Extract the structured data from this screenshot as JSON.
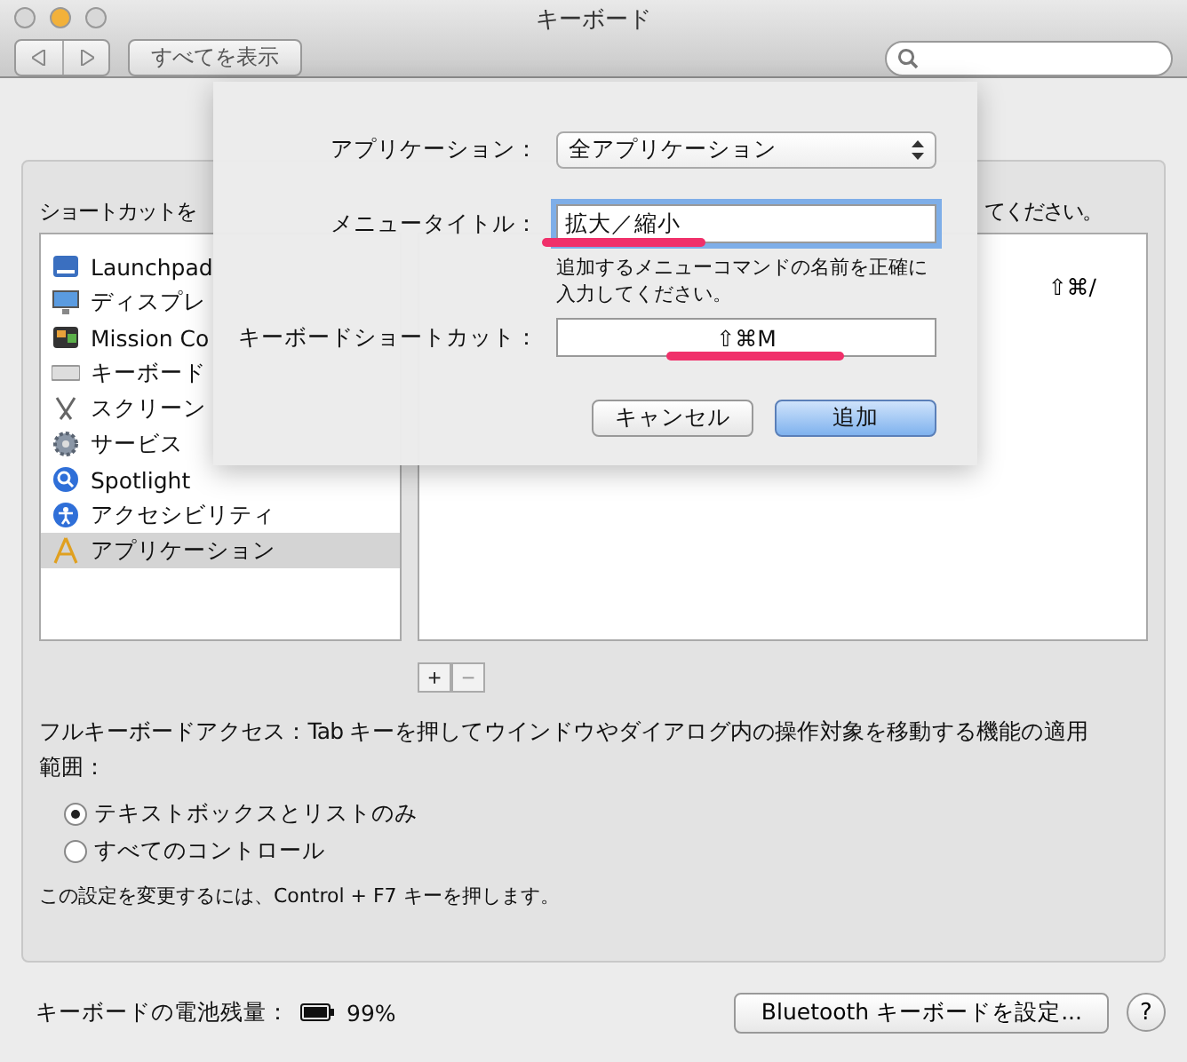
{
  "window": {
    "title": "キーボード"
  },
  "toolbar": {
    "show_all": "すべてを表示"
  },
  "shortcuts": {
    "heading_left": "ショートカットを",
    "heading_right": "てください。",
    "categories": [
      {
        "label": "Launchpad",
        "selected": false
      },
      {
        "label": "ディスプレ",
        "selected": false
      },
      {
        "label": "Mission Co",
        "selected": false
      },
      {
        "label": "キーボード",
        "selected": false
      },
      {
        "label": "スクリーン",
        "selected": false
      },
      {
        "label": "サービス",
        "selected": false
      },
      {
        "label": "Spotlight",
        "selected": false
      },
      {
        "label": "アクセシビリティ",
        "selected": false
      },
      {
        "label": "アプリケーション",
        "selected": true
      }
    ],
    "shortcut_value": "⇧⌘/",
    "add": "+",
    "remove": "−"
  },
  "full_keyboard_access": {
    "description": "フルキーボードアクセス：Tab キーを押してウインドウやダイアログ内の操作対象を移動する機能の適用範囲：",
    "options": [
      {
        "label": "テキストボックスとリストのみ",
        "selected": true
      },
      {
        "label": "すべてのコントロール",
        "selected": false
      }
    ],
    "note": "この設定を変更するには、Control + F7 キーを押します。"
  },
  "footer": {
    "battery_label": "キーボードの電池残量：",
    "battery_value": "99%",
    "bluetooth_button": "Bluetooth キーボードを設定...",
    "help": "?"
  },
  "sheet": {
    "application_label": "アプリケーション：",
    "application_value": "全アプリケーション",
    "menu_title_label": "メニュータイトル：",
    "menu_title_value": "拡大／縮小",
    "hint": "追加するメニューコマンドの名前を正確に入力してください。",
    "shortcut_label": "キーボードショートカット：",
    "shortcut_value": "⇧⌘M",
    "cancel": "キャンセル",
    "add": "追加"
  }
}
